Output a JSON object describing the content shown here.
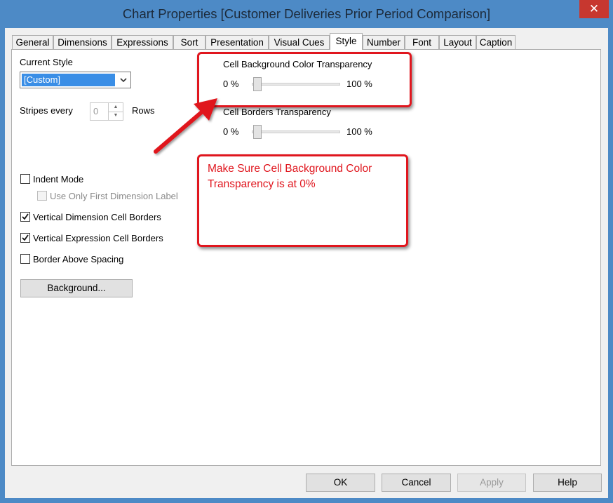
{
  "window": {
    "title": "Chart Properties [Customer Deliveries Prior Period Comparison]",
    "close_glyph": "✕"
  },
  "tabs": [
    {
      "label": "General"
    },
    {
      "label": "Dimensions"
    },
    {
      "label": "Expressions"
    },
    {
      "label": "Sort"
    },
    {
      "label": "Presentation"
    },
    {
      "label": "Visual Cues"
    },
    {
      "label": "Style"
    },
    {
      "label": "Number"
    },
    {
      "label": "Font"
    },
    {
      "label": "Layout"
    },
    {
      "label": "Caption"
    }
  ],
  "style_panel": {
    "current_style_label": "Current Style",
    "current_style_value": "[Custom]",
    "stripes_label": "Stripes every",
    "stripes_value": "0",
    "rows_label": "Rows",
    "cell_bg_transparency_label": "Cell Background Color Transparency",
    "cell_bg_min": "0 %",
    "cell_bg_max": "100 %",
    "cell_bg_value_percent": 0,
    "cell_borders_transparency_label": "Cell Borders Transparency",
    "cell_borders_min": "0 %",
    "cell_borders_max": "100 %",
    "cell_borders_value_percent": 0,
    "indent_mode_label": "Indent Mode",
    "indent_mode_checked": false,
    "first_dim_label": "Use Only First Dimension Label",
    "first_dim_checked": false,
    "vertical_dim_borders_label": "Vertical Dimension Cell Borders",
    "vertical_dim_borders_checked": true,
    "vertical_expr_borders_label": "Vertical Expression Cell Borders",
    "vertical_expr_borders_checked": true,
    "border_above_spacing_label": "Border Above Spacing",
    "border_above_spacing_checked": false,
    "background_button": "Background..."
  },
  "annotation": {
    "text": "Make Sure Cell Background Color Transparency is at 0%",
    "color": "#e0161e"
  },
  "footer": {
    "ok": "OK",
    "cancel": "Cancel",
    "apply": "Apply",
    "help": "Help"
  }
}
